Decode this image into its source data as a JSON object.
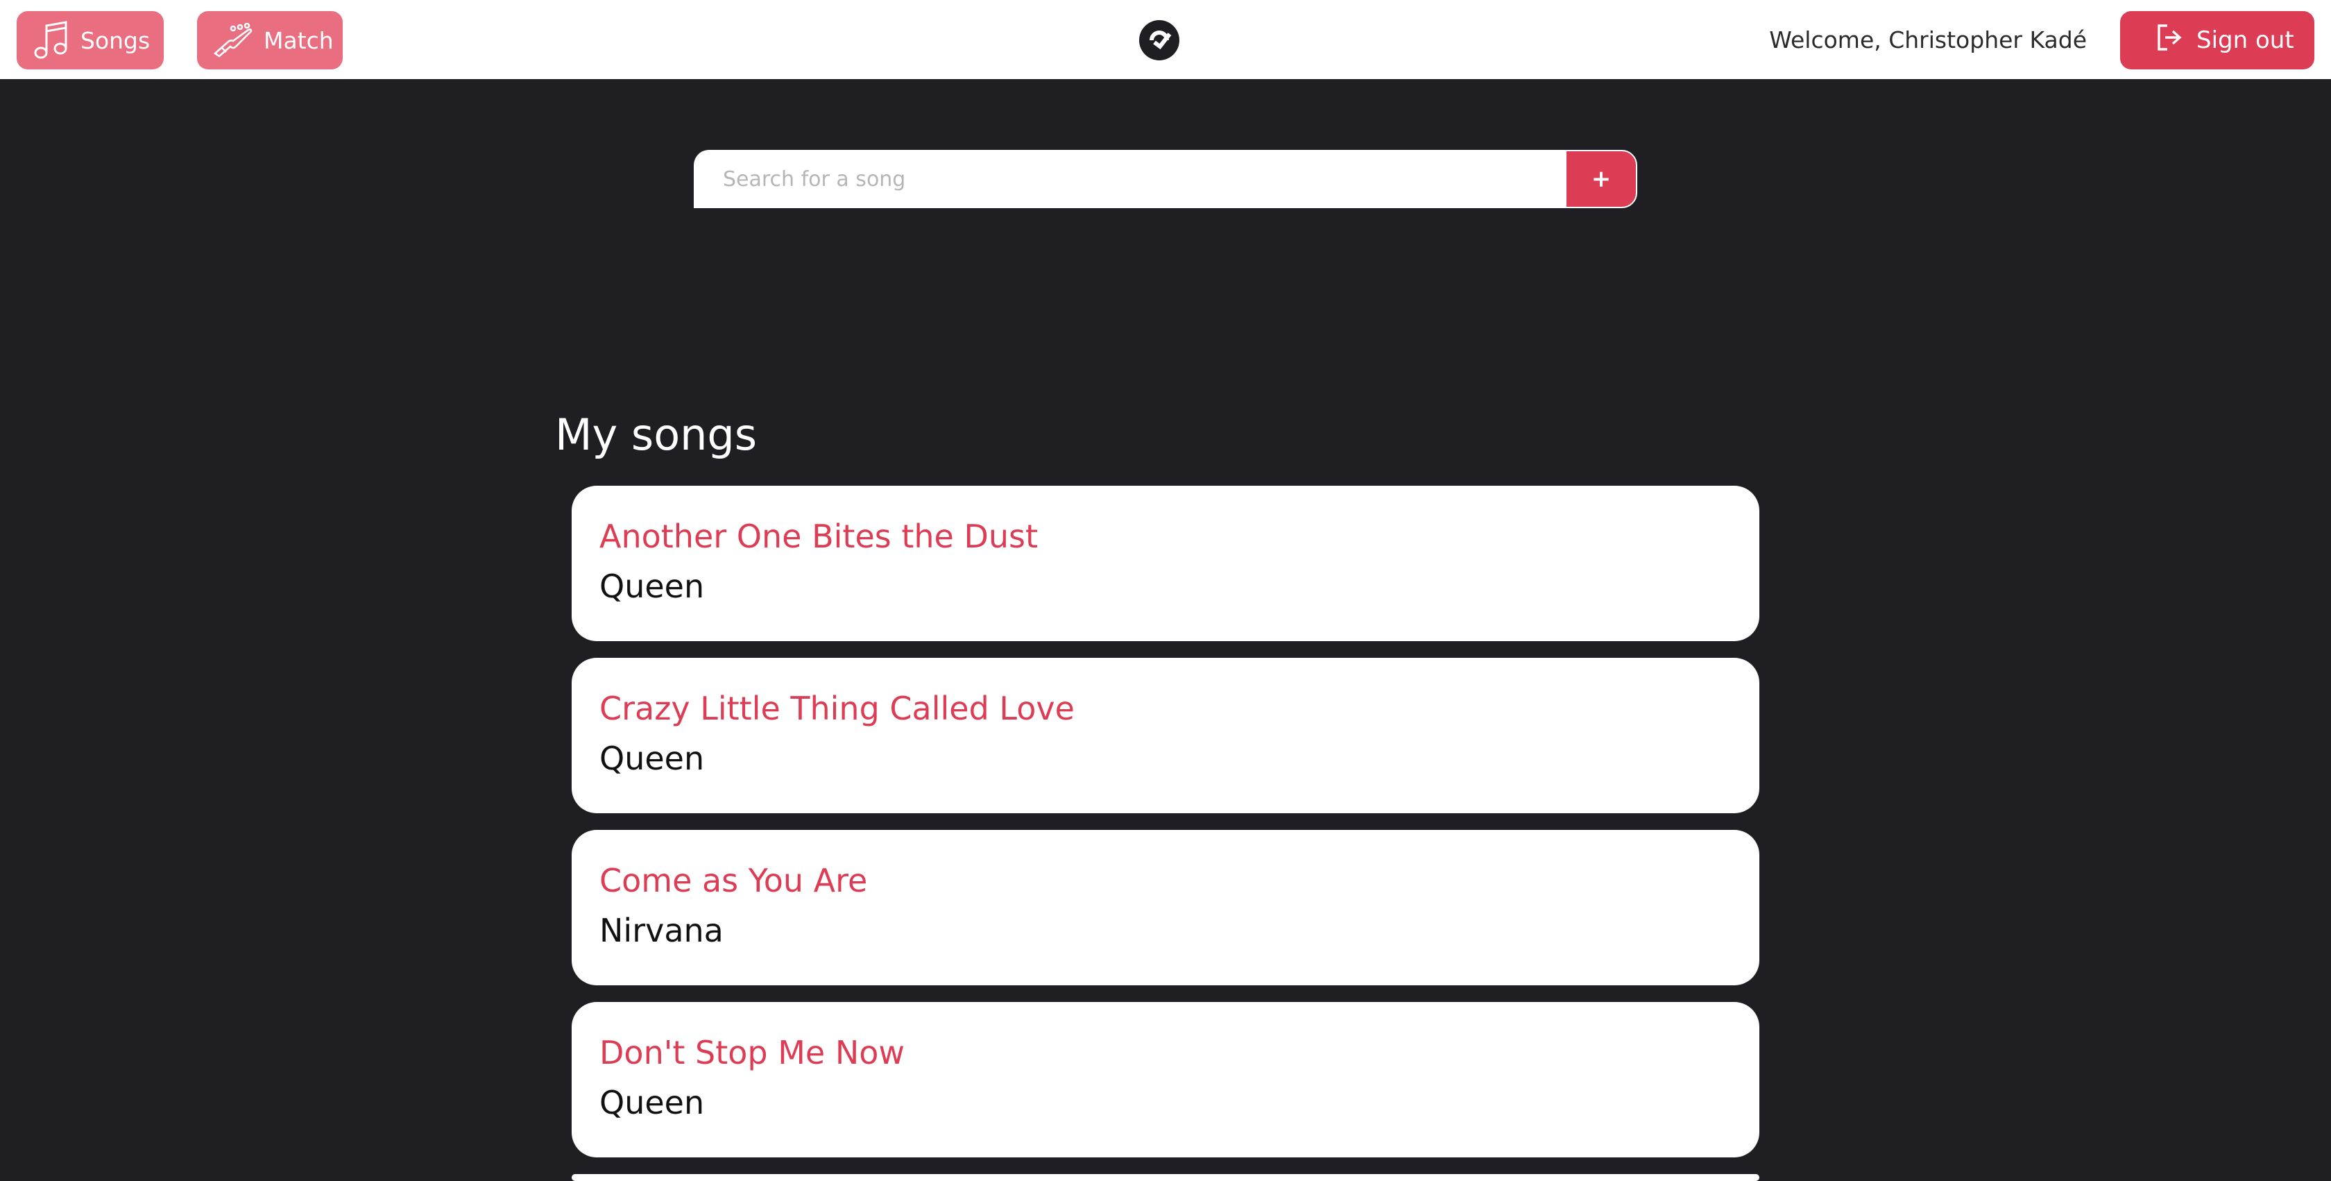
{
  "nav": {
    "songs_label": "Songs",
    "match_label": "Match"
  },
  "header": {
    "welcome_text": "Welcome, Christopher Kadé",
    "signout_label": "Sign out"
  },
  "search": {
    "placeholder": "Search for a song",
    "add_label": "+"
  },
  "songs_section": {
    "title": "My songs",
    "items": [
      {
        "title": "Another One Bites the Dust",
        "artist": "Queen"
      },
      {
        "title": "Crazy Little Thing Called Love",
        "artist": "Queen"
      },
      {
        "title": "Come as You Are",
        "artist": "Nirvana"
      },
      {
        "title": "Don't Stop Me Now",
        "artist": "Queen"
      }
    ]
  },
  "colors": {
    "accent": "#dc3d55",
    "nav_button": "#e96e80",
    "background": "#1f1e23",
    "card": "#ffffff"
  },
  "icons": {
    "songs": "music-note-icon",
    "match": "guitar-headstock-icon",
    "logo": "app-logo-icon",
    "signout": "sign-out-icon"
  }
}
